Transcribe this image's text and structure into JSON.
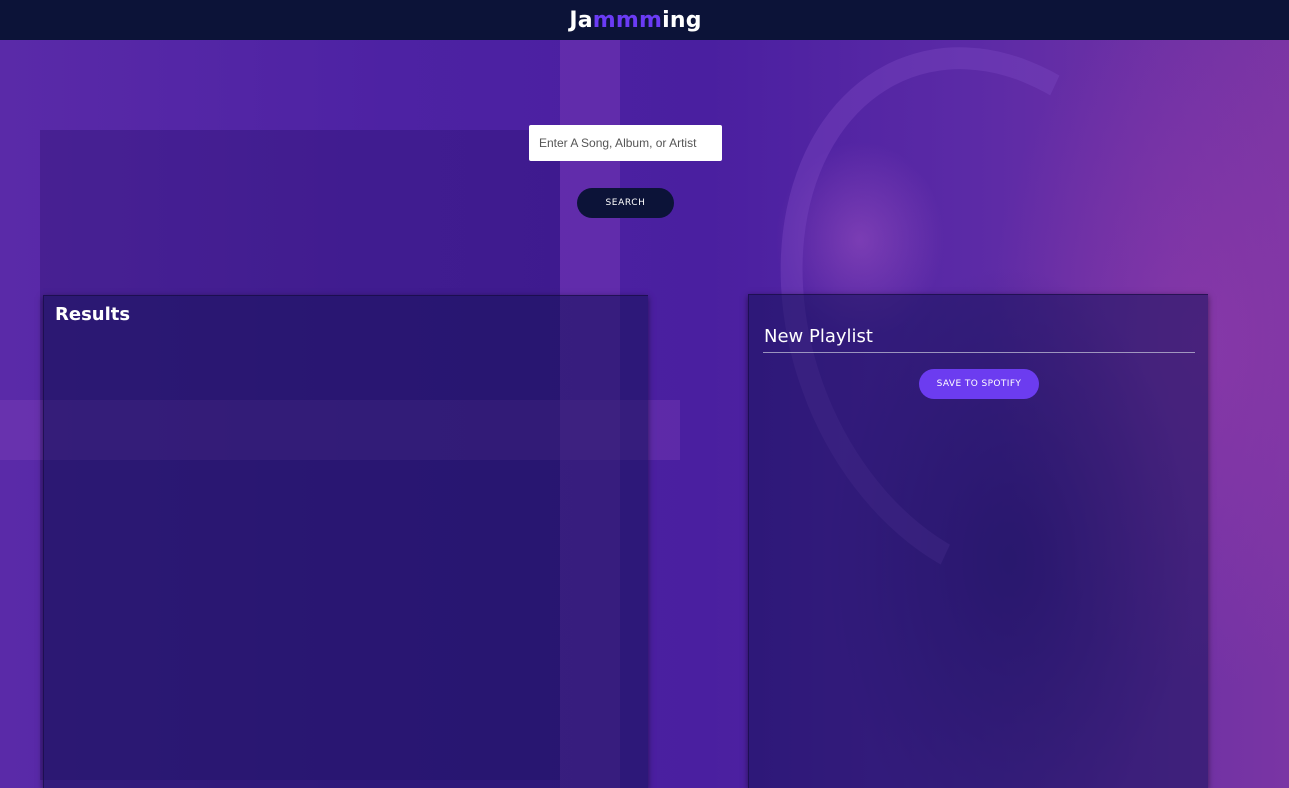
{
  "header": {
    "logo_part1": "Ja",
    "logo_part2": "mmm",
    "logo_part3": "ing"
  },
  "search": {
    "placeholder": "Enter A Song, Album, or Artist",
    "button_label": "SEARCH"
  },
  "results": {
    "title": "Results"
  },
  "playlist": {
    "name": "New Playlist",
    "save_label": "SAVE TO SPOTIFY"
  },
  "colors": {
    "topbar": "#0c1338",
    "accent": "#6c3cf0",
    "background": "#4a1f9c"
  }
}
